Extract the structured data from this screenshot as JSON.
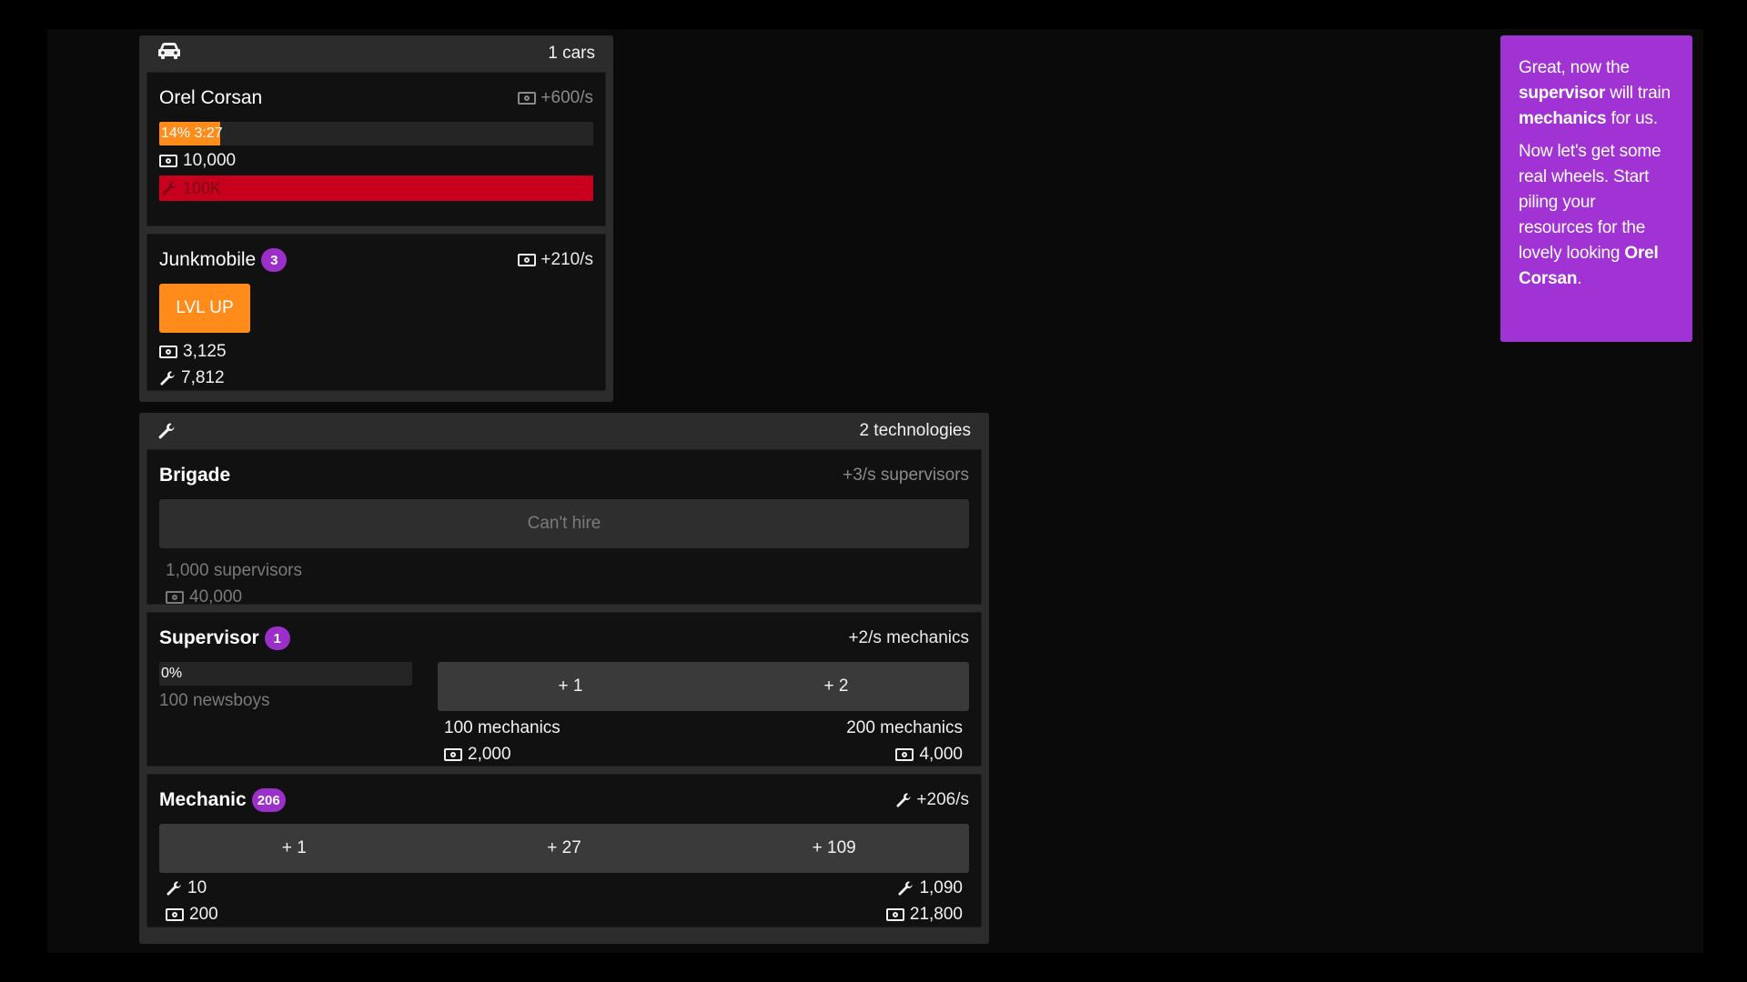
{
  "cars": {
    "header_count": "1 cars",
    "header_icon": "car-icon",
    "items": [
      {
        "name": "Orel Corsan",
        "rate": "+600/s",
        "progress_label": "14% 3:27",
        "progress_fraction": 0.14,
        "money_cost": "10,000",
        "parts_cost": "100K"
      },
      {
        "name": "Junkmobile",
        "level": "3",
        "rate": "+210/s",
        "button": "LVL UP",
        "money_cost": "3,125",
        "parts_cost": "7,812"
      }
    ]
  },
  "technologies": {
    "header_count": "2 technologies",
    "header_icon": "wrench-icon",
    "brigade": {
      "name": "Brigade",
      "rate": "+3/s supervisors",
      "button": "Can't hire",
      "req_supervisors": "1,000 supervisors",
      "req_money": "40,000"
    },
    "supervisor": {
      "name": "Supervisor",
      "count": "1",
      "rate": "+2/s mechanics",
      "progress_label": "0%",
      "progress_fraction": 0,
      "req_newsboys": "100 newsboys",
      "buttons": [
        "+ 1",
        "+ 2"
      ],
      "left_cost_mechanics": "100 mechanics",
      "left_cost_money": "2,000",
      "right_cost_mechanics": "200 mechanics",
      "right_cost_money": "4,000"
    },
    "mechanic": {
      "name": "Mechanic",
      "count": "206",
      "rate": "+206/s",
      "buttons": [
        "+ 1",
        "+ 27",
        "+ 109"
      ],
      "left_cost_parts": "10",
      "left_cost_money": "200",
      "right_cost_parts": "1,090",
      "right_cost_money": "21,800"
    }
  },
  "tip": {
    "p1_a": "Great, now the ",
    "p1_b": "supervisor",
    "p1_c": " will train ",
    "p1_d": "mechanics",
    "p1_e": " for us.",
    "p2_a": "Now let's get some real wheels. Start piling your resources for the lovely looking ",
    "p2_b": "Orel Corsan",
    "p2_c": "."
  },
  "colors": {
    "accent_orange": "#ff8c1a",
    "accent_purple": "#a132d3",
    "badge_purple": "#9b2fc9",
    "danger_red": "#c8001e"
  }
}
